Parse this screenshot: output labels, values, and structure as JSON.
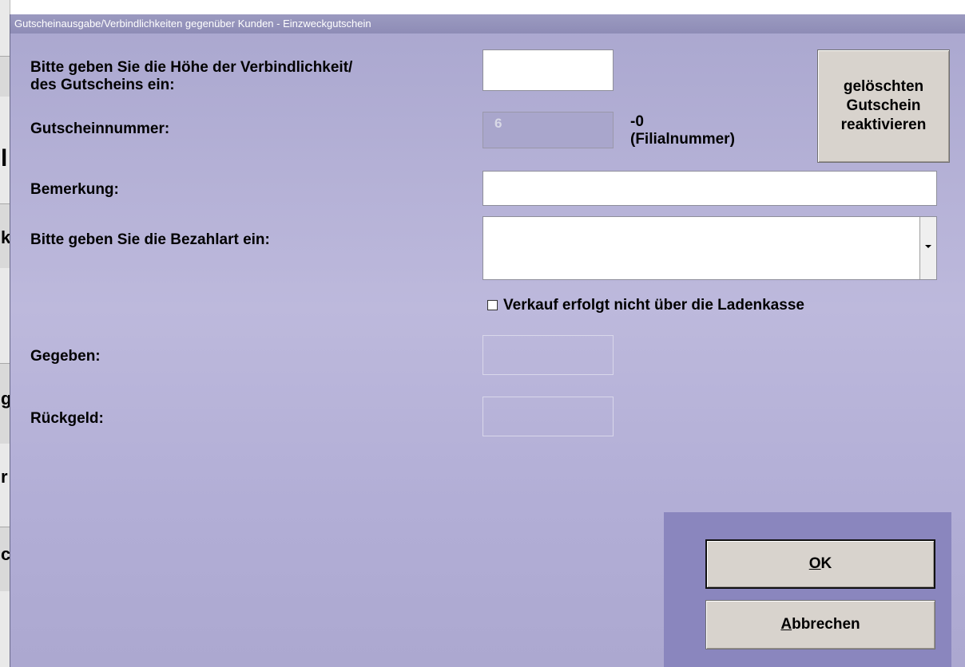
{
  "window": {
    "title": "Gutscheinausgabe/Verbindlichkeiten gegenüber Kunden - Einzweckgutschein"
  },
  "background": {
    "glyphs": [
      "l",
      "k",
      "g",
      "r",
      "c"
    ]
  },
  "form": {
    "amount": {
      "label_line1": "Bitte geben Sie die Höhe der Verbindlichkeit/",
      "label_line2": "des Gutscheins ein:",
      "value": ""
    },
    "voucher_number": {
      "label": "Gutscheinnummer:",
      "value": "6",
      "suffix": "-0",
      "suffix_note": "(Filialnummer)"
    },
    "remark": {
      "label": "Bemerkung:",
      "value": ""
    },
    "payment_method": {
      "label": "Bitte geben Sie die Bezahlart ein:",
      "value": ""
    },
    "not_register_sale": {
      "label": "Verkauf erfolgt nicht über die Ladenkasse",
      "checked": false
    },
    "given": {
      "label": "Gegeben:",
      "value": ""
    },
    "change": {
      "label": "Rückgeld:",
      "value": ""
    }
  },
  "buttons": {
    "reactivate_line1": "gelöschten",
    "reactivate_line2": "Gutschein",
    "reactivate_line3": "reaktivieren",
    "ok_mnemonic": "O",
    "ok_rest": "K",
    "cancel_mnemonic": "A",
    "cancel_rest": "bbrechen"
  }
}
